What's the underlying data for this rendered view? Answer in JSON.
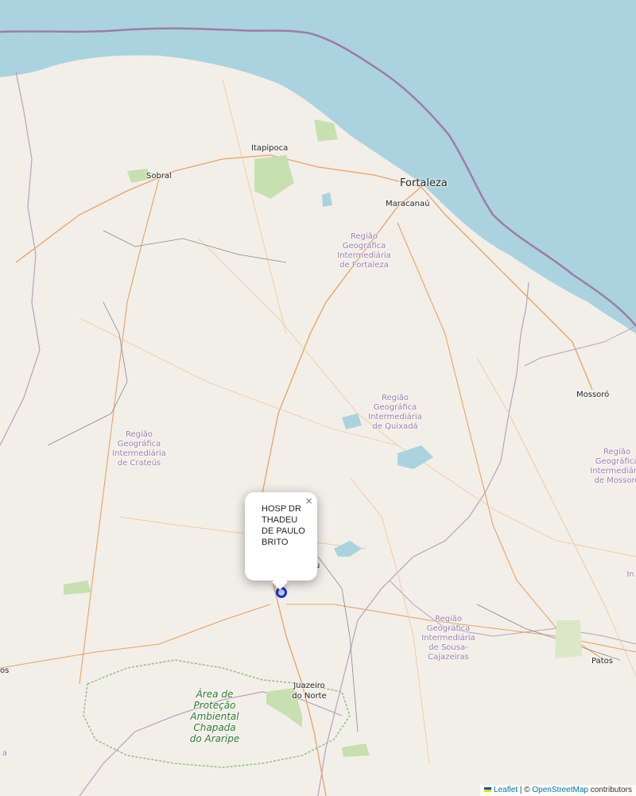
{
  "map": {
    "cities": [
      {
        "name": "Fortaleza",
        "major": true
      },
      {
        "name": "Maracanaú",
        "major": false
      },
      {
        "name": "Itapipoca",
        "major": false
      },
      {
        "name": "Sobral",
        "major": false
      },
      {
        "name": "Mossoró",
        "major": false
      },
      {
        "name": "Patos",
        "major": false
      },
      {
        "name": "Juazeiro do Norte",
        "major": false
      }
    ],
    "regions": [
      "Região Geográfica Intermediária de Fortaleza",
      "Região Geográfica Intermediária de Quixadá",
      "Região Geográfica Intermediária de Crateús",
      "Região Geográfica Intermediária de Sousa-Cajazeiras",
      "Região Geográfica Intermediária de Mossoró"
    ],
    "park": "Área de Proteção Ambiental Chapada do Araripe",
    "edge_labels": [
      "os",
      "a",
      "u",
      "In"
    ],
    "colors": {
      "sea": "#aad3df",
      "land": "#f2efe9",
      "park": "#c8dfb0",
      "marker": "#1a2edb",
      "boundary": "#9e7ca6"
    }
  },
  "popup": {
    "text": "HOSP DR THADEU DE PAULO BRITO",
    "close_label": "×"
  },
  "marker": {
    "name": "HOSP DR THADEU DE PAULO BRITO"
  },
  "attribution": {
    "leaflet": "Leaflet",
    "separator": " | © ",
    "osm": "OpenStreetMap",
    "suffix": " contributors"
  }
}
